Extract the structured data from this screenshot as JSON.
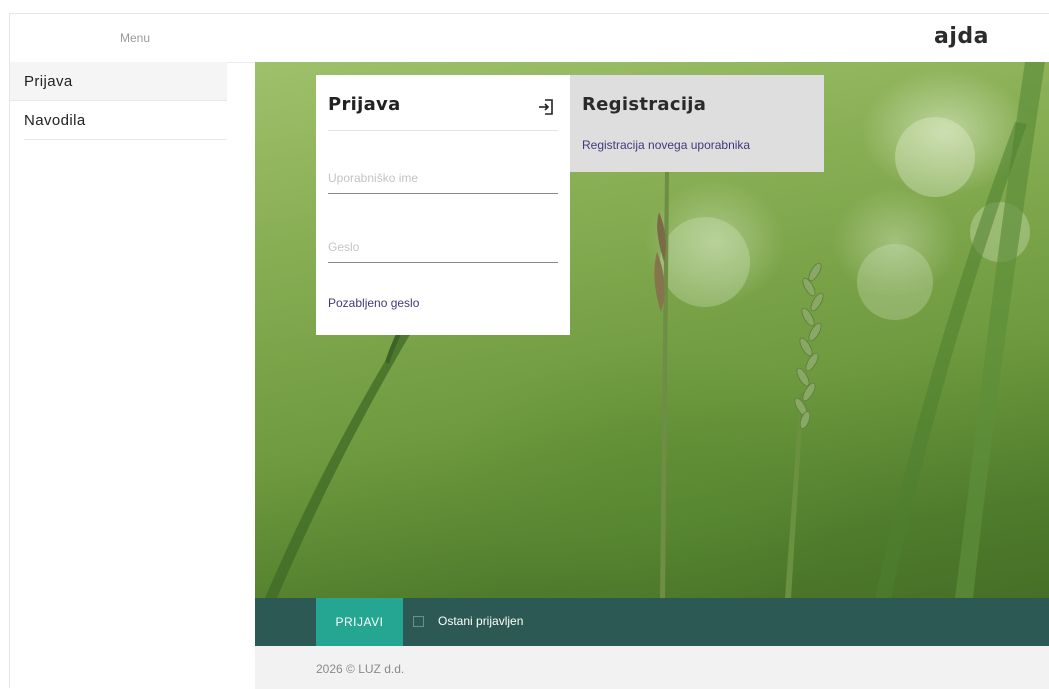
{
  "header": {
    "menu_label": "Menu",
    "logo": "ajda"
  },
  "sidebar": {
    "items": [
      {
        "label": "Prijava",
        "active": true
      },
      {
        "label": "Navodila",
        "active": false
      }
    ]
  },
  "login": {
    "title": "Prijava",
    "icon": "login-icon",
    "username_placeholder": "Uporabniško ime",
    "password_placeholder": "Geslo",
    "forgot_link": "Pozabljeno geslo"
  },
  "registration": {
    "title": "Registracija",
    "link": "Registracija novega uporabnika"
  },
  "actions": {
    "submit_label": "PRIJAVI",
    "remember_label": "Ostani prijavljen",
    "remember_checked": false
  },
  "footer": {
    "copyright": "2026 © LUZ d.d."
  },
  "colors": {
    "accent": "#24a693",
    "action_bar": "#2d5954",
    "link": "#3f3a7c"
  }
}
